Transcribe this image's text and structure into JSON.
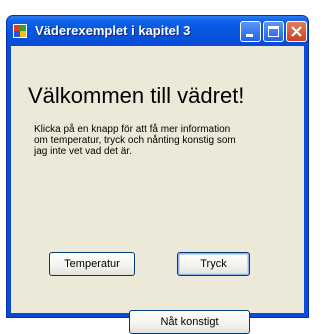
{
  "window": {
    "title": "Väderexemplet i kapitel 3"
  },
  "main": {
    "heading": "Välkommen till vädret!",
    "description": "Klicka på en knapp för att få mer information om temperatur, tryck och nånting konstig som jag inte vet vad det är."
  },
  "buttons": {
    "temperatur": "Temperatur",
    "tryck": "Tryck",
    "nat_konstigt": "Nåt konstigt"
  },
  "colors": {
    "titlebar": "#0a4ad6",
    "client_background": "#ece9d8",
    "close_button": "#c9421f"
  }
}
